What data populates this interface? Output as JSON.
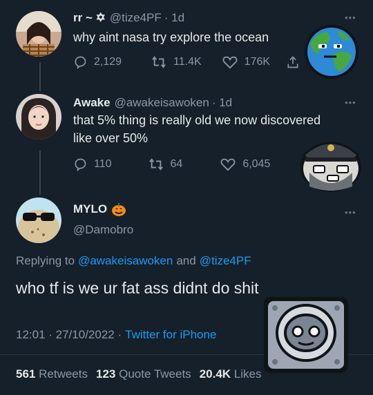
{
  "tweet1": {
    "display_name": "rr ~ ✡",
    "handle": "@tize4PF",
    "time": "· 1d",
    "text": "why aint nasa try explore the ocean",
    "replies": "2,129",
    "retweets": "11.4K",
    "likes": "176K"
  },
  "tweet2": {
    "display_name": "Awake",
    "handle": "@awakeisawoken",
    "time": "· 1d",
    "text_line1": "that 5% thing is really old we now discovered",
    "text_line2": "like over 50%",
    "replies": "110",
    "retweets": "64",
    "likes": "6,045"
  },
  "main_tweet": {
    "display_name": "MYLO",
    "handle": "@Damobro",
    "replying_prefix": "Replying to",
    "reply_to_1": "@awakeisawoken",
    "reply_and": "and",
    "reply_to_2": "@tize4PF",
    "text": "who tf is we ur fat ass didnt do shit",
    "timestamp": "12:01 · 27/10/2022 ·",
    "client": "Twitter for iPhone",
    "retweets_count": "561",
    "retweets_label": "Retweets",
    "quote_count": "123",
    "quote_label": "Quote Tweets",
    "likes_count": "20.4K",
    "likes_label": "Likes"
  },
  "colors": {
    "background": "#15202b",
    "text": "#e7e9ea",
    "muted": "#8b98a5",
    "link": "#1d9bf0"
  }
}
